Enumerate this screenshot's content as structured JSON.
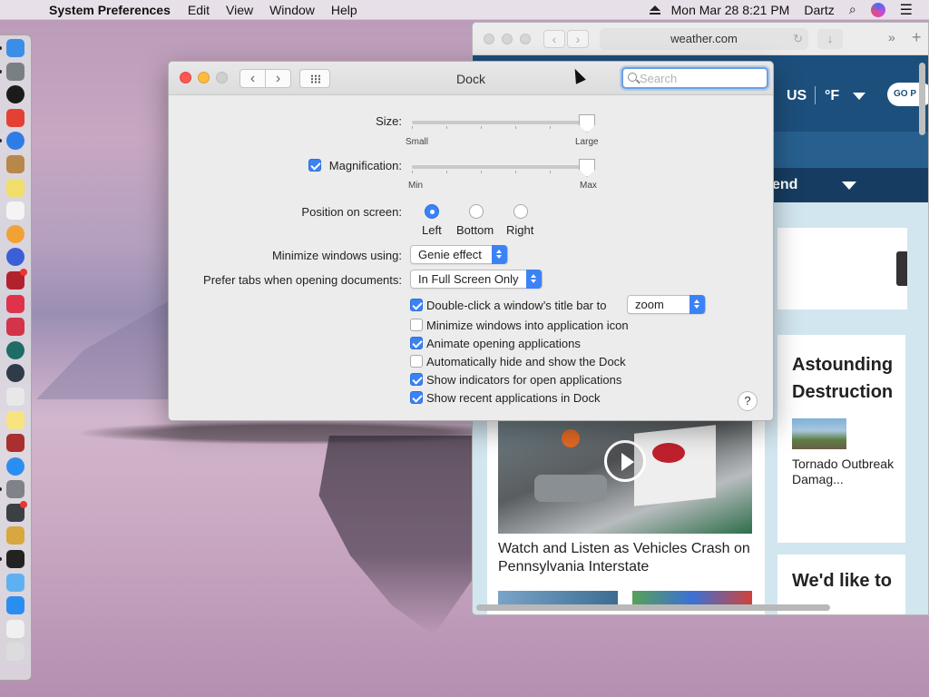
{
  "menubar": {
    "app_name": "System Preferences",
    "menus": [
      "Edit",
      "View",
      "Window",
      "Help"
    ],
    "clock": "Mon Mar 28  8:21 PM",
    "user": "Dartz"
  },
  "safari": {
    "url": "weather.com",
    "region": "US",
    "unit": "°F",
    "go_button": "GO P",
    "trending_label": "end",
    "video_headline": "Watch and Listen as Vehicles Crash on Pennsylvania Interstate",
    "side_card_title": "Astounding Destruction",
    "side_card_caption": "Tornado Outbreak Damag...",
    "side_card2_title": "We'd like to"
  },
  "prefs": {
    "title": "Dock",
    "search_placeholder": "Search",
    "size_label": "Size:",
    "size_min": "Small",
    "size_max": "Large",
    "size_value": 1.0,
    "magnification_label": "Magnification:",
    "magnification_checked": true,
    "mag_min": "Min",
    "mag_max": "Max",
    "mag_value": 1.0,
    "position_label": "Position on screen:",
    "position_options": [
      "Left",
      "Bottom",
      "Right"
    ],
    "position_selected": "Left",
    "minimize_label": "Minimize windows using:",
    "minimize_value": "Genie effect",
    "prefer_tabs_label": "Prefer tabs when opening documents:",
    "prefer_tabs_value": "In Full Screen Only",
    "double_click_label": "Double-click a window’s title bar to",
    "double_click_value": "zoom",
    "checkboxes": [
      {
        "label": "Double-click a window’s title bar to",
        "checked": true
      },
      {
        "label": "Minimize windows into application icon",
        "checked": false
      },
      {
        "label": "Animate opening applications",
        "checked": true
      },
      {
        "label": "Automatically hide and show the Dock",
        "checked": false
      },
      {
        "label": "Show indicators for open applications",
        "checked": true
      },
      {
        "label": "Show recent applications in Dock",
        "checked": true
      }
    ],
    "help": "?"
  },
  "dock_icons": [
    {
      "name": "finder-icon",
      "color": "#3b8ee8"
    },
    {
      "name": "launchpad-icon",
      "color": "#7a7f86"
    },
    {
      "name": "siri-icon",
      "color": "#1b1b1b"
    },
    {
      "name": "chrome-icon",
      "color": "#e34133"
    },
    {
      "name": "safari-icon",
      "color": "#2f7ce6"
    },
    {
      "name": "notefile-icon",
      "color": "#b8874a"
    },
    {
      "name": "stickies-icon",
      "color": "#f2de6a"
    },
    {
      "name": "calendar-icon",
      "color": "#f4f4f4"
    },
    {
      "name": "photos-icon",
      "color": "#f0a234"
    },
    {
      "name": "itunes-icon",
      "color": "#3c5fd8"
    },
    {
      "name": "photobooth-icon",
      "color": "#b2222d"
    },
    {
      "name": "block-icon",
      "color": "#e0334b"
    },
    {
      "name": "app-red-icon",
      "color": "#d2344a"
    },
    {
      "name": "time-machine-icon",
      "color": "#1f6b66"
    },
    {
      "name": "quicktime-icon",
      "color": "#2f3a4a"
    },
    {
      "name": "textedit-icon",
      "color": "#e8e8e8"
    },
    {
      "name": "notes-icon",
      "color": "#f7e480"
    },
    {
      "name": "dictionary-icon",
      "color": "#a9302e"
    },
    {
      "name": "app-store-icon",
      "color": "#2a8ef0"
    },
    {
      "name": "system-preferences-icon",
      "color": "#7f8389"
    },
    {
      "name": "xcode-icon",
      "color": "#3b3f46"
    },
    {
      "name": "car-icon",
      "color": "#d8a740"
    },
    {
      "name": "terminal-icon",
      "color": "#222222"
    },
    {
      "name": "mail-icon",
      "color": "#5fb0f0"
    },
    {
      "name": "downloads-icon",
      "color": "#2a8ef0"
    },
    {
      "name": "document-icon",
      "color": "#f0f0f0"
    },
    {
      "name": "trash-icon",
      "color": "#dcdcdc"
    }
  ]
}
